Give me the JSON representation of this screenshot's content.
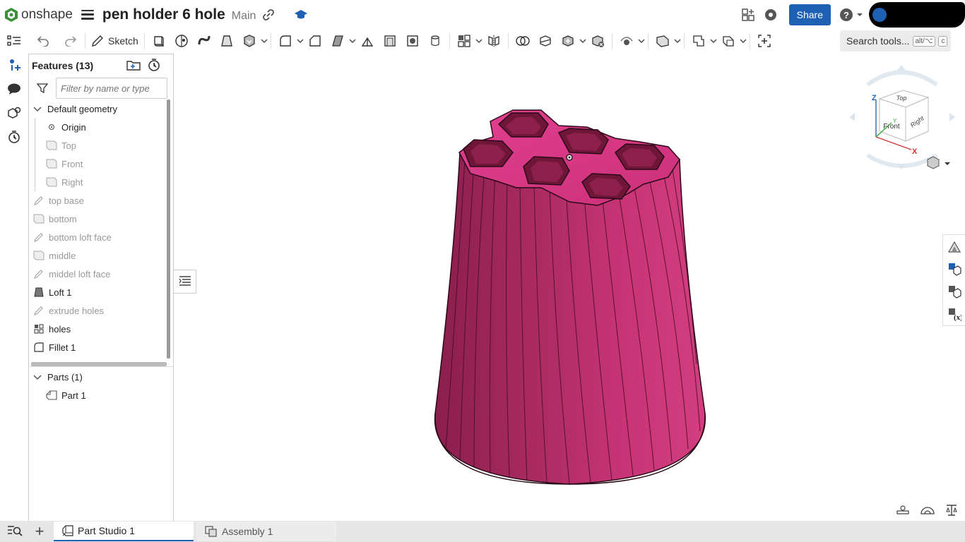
{
  "app": {
    "logo_text": "onshape"
  },
  "document": {
    "title": "pen holder 6 hole",
    "branch": "Main"
  },
  "header": {
    "share_label": "Share"
  },
  "toolbar": {
    "sketch_label": "Sketch",
    "search_label": "Search tools...",
    "search_shortcut_1": "alt/⌥",
    "search_shortcut_2": "c"
  },
  "features": {
    "title": "Features (13)",
    "filter_placeholder": "Filter by name or type",
    "default_geometry": "Default geometry",
    "origin": "Origin",
    "planes": [
      "Top",
      "Front",
      "Right"
    ],
    "items": [
      {
        "label": "top base",
        "icon": "sketch-icon",
        "faded": true
      },
      {
        "label": "bottom",
        "icon": "plane-icon",
        "faded": true
      },
      {
        "label": "bottom loft face",
        "icon": "sketch-icon",
        "faded": true
      },
      {
        "label": "middle",
        "icon": "plane-icon",
        "faded": true
      },
      {
        "label": "middel loft face",
        "icon": "sketch-icon",
        "faded": true
      },
      {
        "label": "Loft 1",
        "icon": "loft-icon",
        "faded": false
      },
      {
        "label": "extrude holes",
        "icon": "sketch-icon",
        "faded": true
      },
      {
        "label": "holes",
        "icon": "pattern-icon",
        "faded": false
      },
      {
        "label": "Fillet 1",
        "icon": "fillet-icon",
        "faded": false
      }
    ]
  },
  "parts": {
    "title": "Parts (1)",
    "items": [
      "Part 1"
    ]
  },
  "view_cube": {
    "top": "Top",
    "front": "Front",
    "right": "Right",
    "axis_x": "X",
    "axis_y": "Y",
    "axis_z": "Z"
  },
  "tabs": [
    {
      "label": "Part Studio 1",
      "active": true
    },
    {
      "label": "Assembly 1",
      "active": false
    }
  ],
  "colors": {
    "accent": "#1e60b4",
    "model": "#c2306e"
  }
}
